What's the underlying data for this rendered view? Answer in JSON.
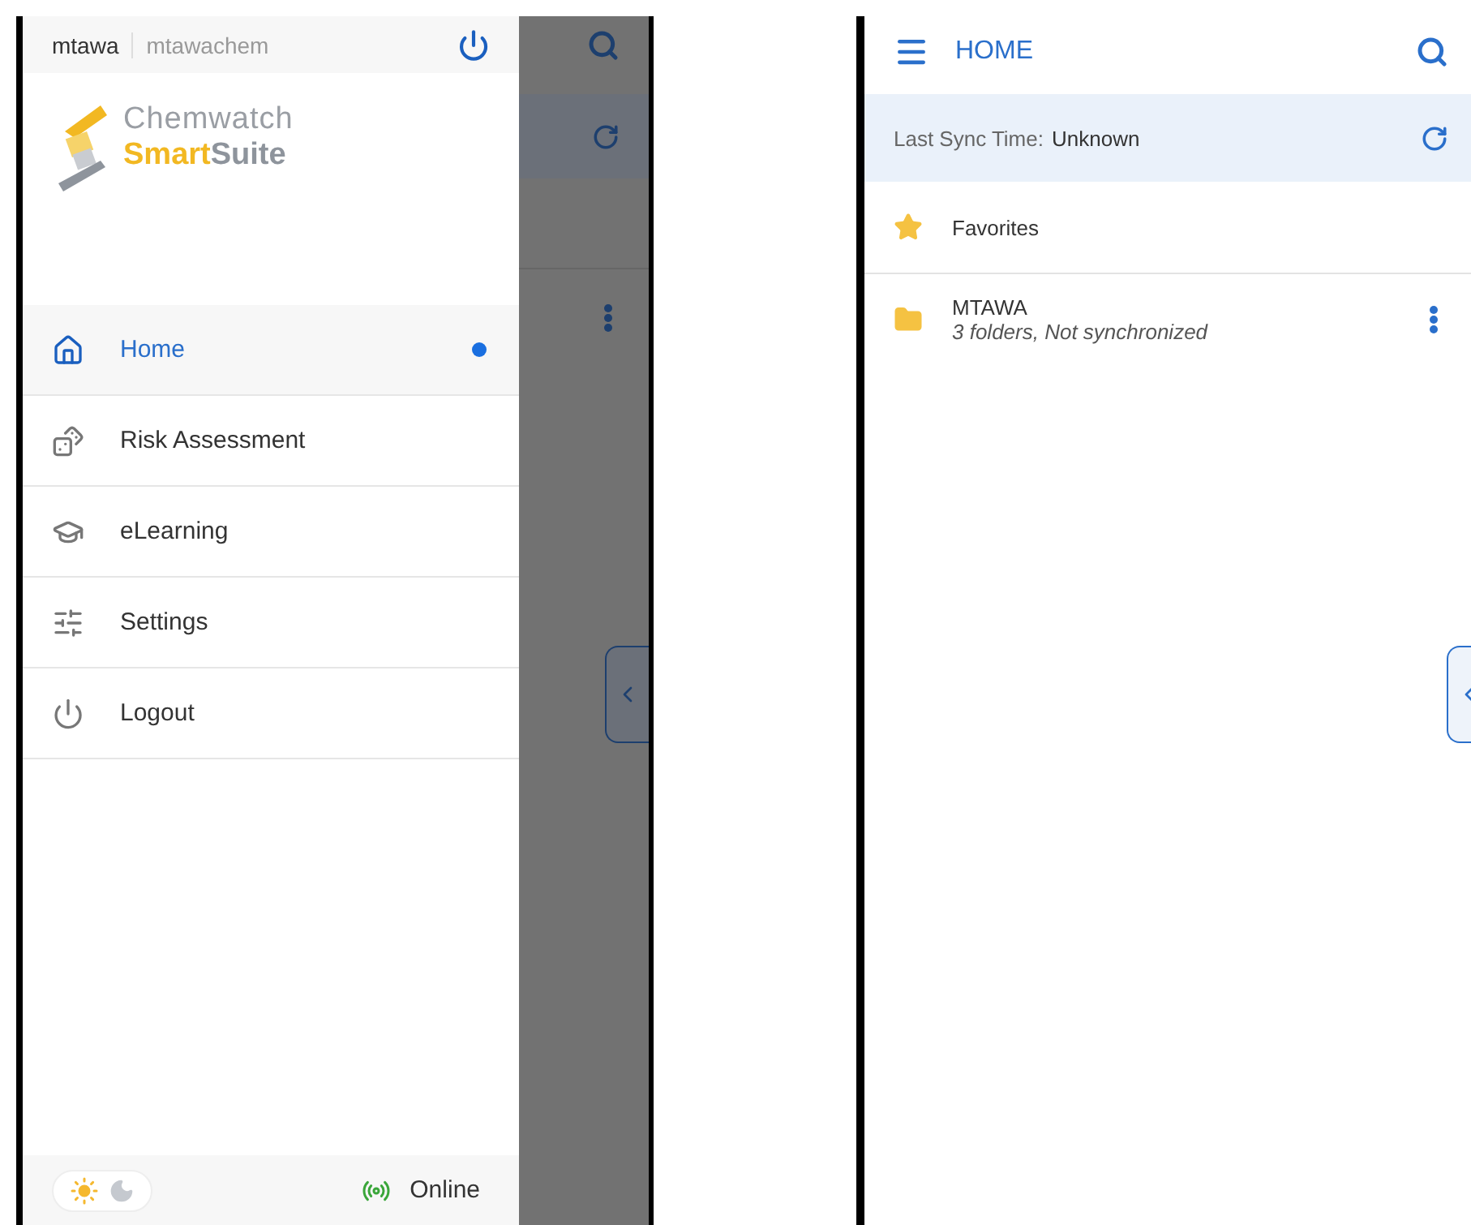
{
  "drawer": {
    "account": {
      "user": "mtawa",
      "organization": "mtawachem"
    },
    "logo": {
      "line1": "Chemwatch",
      "line2_accent": "Smart",
      "line2_rest": "Suite"
    },
    "menu": [
      {
        "kind": "home",
        "label": "Home",
        "selected": true
      },
      {
        "kind": "risk",
        "label": "Risk Assessment",
        "selected": false
      },
      {
        "kind": "learning",
        "label": "eLearning",
        "selected": false
      },
      {
        "kind": "settings",
        "label": "Settings",
        "selected": false
      },
      {
        "kind": "logout",
        "label": "Logout",
        "selected": false
      }
    ],
    "footer": {
      "light_theme": true,
      "status": "Online"
    }
  },
  "home_screen": {
    "title": "HOME",
    "sync_label": "Last Sync Time:",
    "sync_value": "Unknown",
    "items": [
      {
        "kind": "favorites",
        "title": "Favorites"
      },
      {
        "kind": "folder",
        "title": "MTAWA",
        "subtitle": "3 folders, Not synchronized"
      }
    ]
  }
}
